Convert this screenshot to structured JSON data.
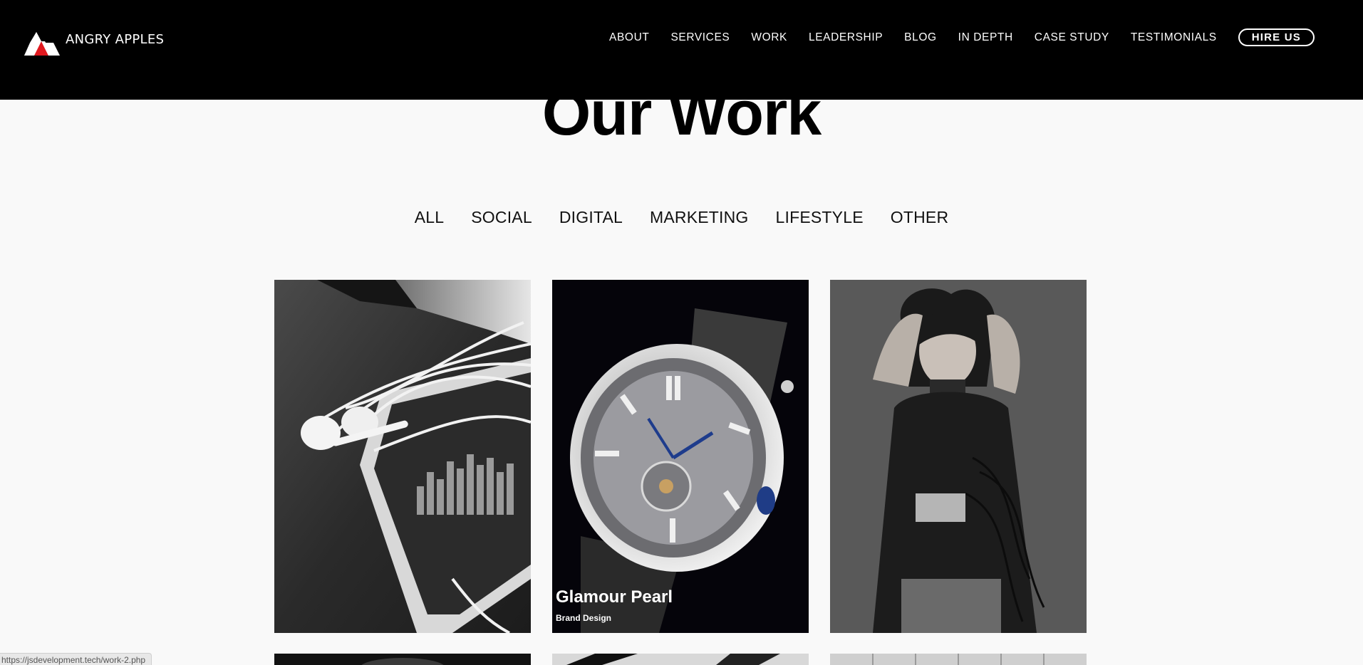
{
  "brand": {
    "name": "ANGRY APPLES",
    "accent": "#e0191f"
  },
  "nav": {
    "items": [
      "ABOUT",
      "SERVICES",
      "WORK",
      "LEADERSHIP",
      "BLOG",
      "IN DEPTH",
      "CASE STUDY",
      "TESTIMONIALS"
    ],
    "cta": "HIRE US"
  },
  "page": {
    "title": "Our Work"
  },
  "filters": [
    "ALL",
    "SOCIAL",
    "DIGITAL",
    "MARKETING",
    "LIFESTYLE",
    "OTHER"
  ],
  "portfolio": [
    {
      "image": "earphones-phone-photo",
      "title": "",
      "subtitle": ""
    },
    {
      "image": "luxury-watch-photo",
      "title": "Glamour Pearl",
      "subtitle": "Brand Design"
    },
    {
      "image": "fashion-model-photo",
      "title": "",
      "subtitle": ""
    },
    {
      "image": "portrait-photo",
      "title": "",
      "subtitle": ""
    },
    {
      "image": "monochrome-photo",
      "title": "",
      "subtitle": ""
    },
    {
      "image": "interior-photo",
      "title": "",
      "subtitle": ""
    }
  ],
  "status_bar": {
    "url": "https://jsdevelopment.tech/work-2.php"
  }
}
